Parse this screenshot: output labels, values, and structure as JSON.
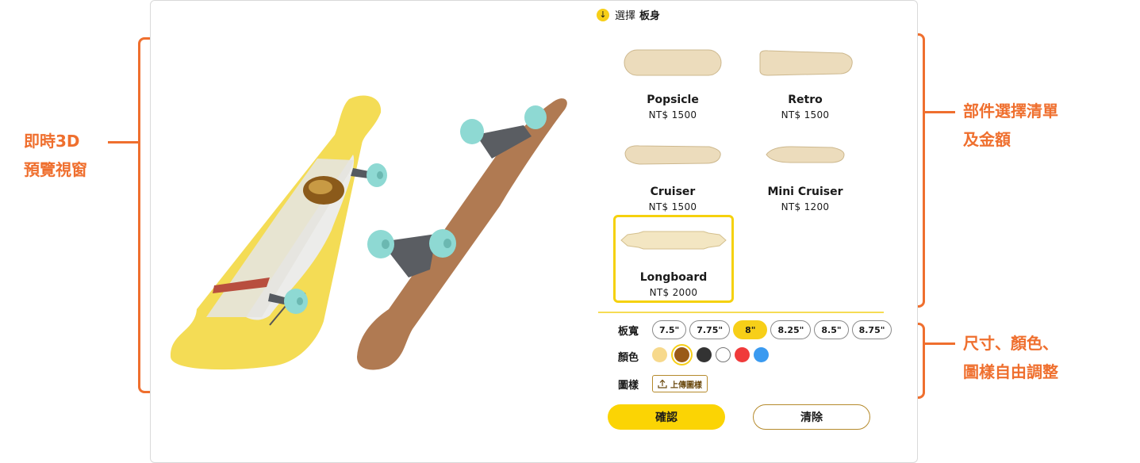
{
  "annotations": {
    "left_line1": "即時3D",
    "left_line2": "預覽視窗",
    "right_top_line1": "部件選擇清單",
    "right_top_line2": "及金額",
    "right_bottom_line1": "尺寸、顏色、",
    "right_bottom_line2": "圖樣自由調整",
    "color": "#ef6f2e"
  },
  "panel": {
    "heading_prefix": "選擇",
    "heading_part": "板身",
    "heading_icon": "arrow-down-circle-icon"
  },
  "decks": [
    {
      "name": "Popsicle",
      "price": "NT$  1500"
    },
    {
      "name": "Retro",
      "price": "NT$  1500"
    },
    {
      "name": "Cruiser",
      "price": "NT$  1500"
    },
    {
      "name": "Mini Cruiser",
      "price": "NT$  1200"
    },
    {
      "name": "Longboard",
      "price": "NT$  2000",
      "selected": true
    }
  ],
  "options": {
    "width_label": "板寬",
    "sizes": [
      "7.5\"",
      "7.75\"",
      "8\"",
      "8.25\"",
      "8.5\"",
      "8.75\""
    ],
    "selected_size": "8\"",
    "color_label": "顏色",
    "colors": [
      "#f7d98c",
      "#9a5a17",
      "#333333",
      "#ffffff",
      "#f03a3a",
      "#3a9af0"
    ],
    "selected_color": "#9a5a17",
    "pattern_label": "圖樣",
    "upload_label": "上傳圖樣"
  },
  "actions": {
    "confirm": "確認",
    "clear": "清除"
  },
  "accent_color": "#f7cf18"
}
